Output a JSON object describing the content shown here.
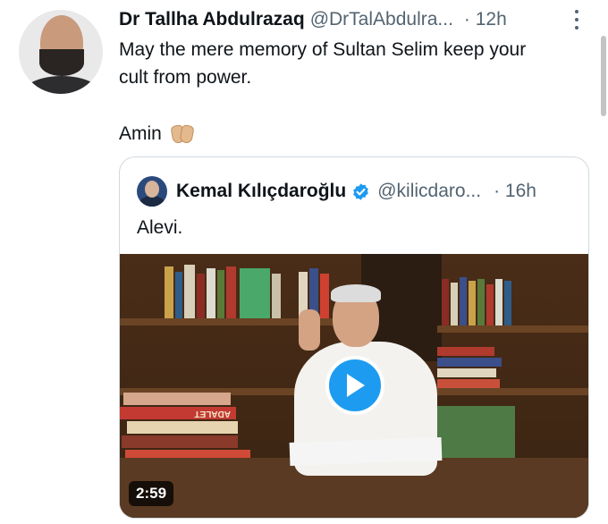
{
  "tweet": {
    "author_name": "Dr Tallha Abdulrazaq",
    "author_handle": "@DrTalAbdulra...",
    "time": "· 12h",
    "text_lines": [
      "May the mere memory of Sultan Selim keep your",
      "cult from power."
    ],
    "amin_text": "Amin",
    "amin_icon": "folded-hands-icon"
  },
  "quote": {
    "author_name": "Kemal Kılıçdaroğlu",
    "verified_icon": "verified-badge-icon",
    "author_handle": "@kilicdaro...",
    "time": "· 16h",
    "text": "Alevi.",
    "video": {
      "duration": "2:59",
      "play_icon": "play-icon",
      "book_spine_text": "ADALET"
    }
  },
  "colors": {
    "text_primary": "#0f1419",
    "text_secondary": "#536471",
    "accent": "#1d9bf0",
    "border": "#cfd9de"
  }
}
